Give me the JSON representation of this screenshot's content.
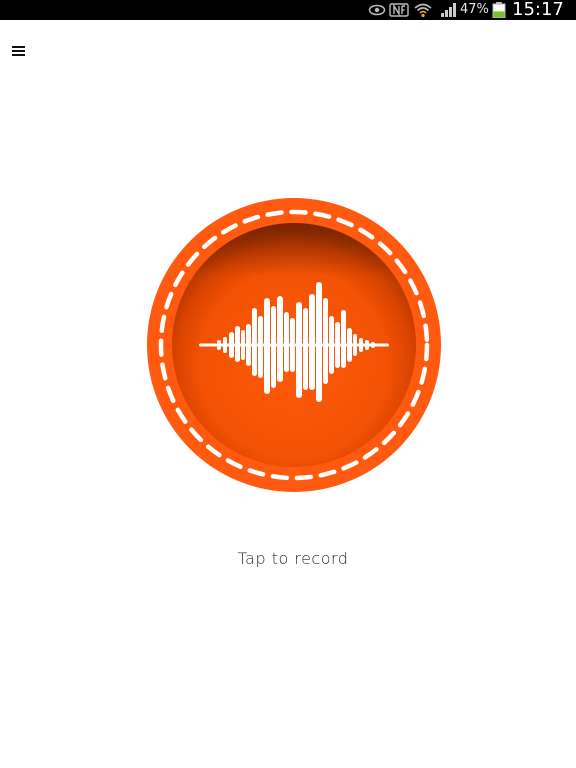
{
  "status_bar": {
    "battery_percent": "47%",
    "clock": "15:17",
    "battery_level": 0.47,
    "icons": [
      "eye-icon",
      "nfc-icon",
      "wifi-icon",
      "signal-icon",
      "battery-icon"
    ]
  },
  "toolbar": {
    "menu_icon": "hamburger-menu-icon"
  },
  "main": {
    "record_button_icon": "waveform-icon",
    "record_label": "Tap to record"
  },
  "colors": {
    "accent": "#ff5a0f",
    "accent_dark": "#e84a00",
    "battery_green": "#7cc12a",
    "status_bar_bg": "#000000"
  }
}
